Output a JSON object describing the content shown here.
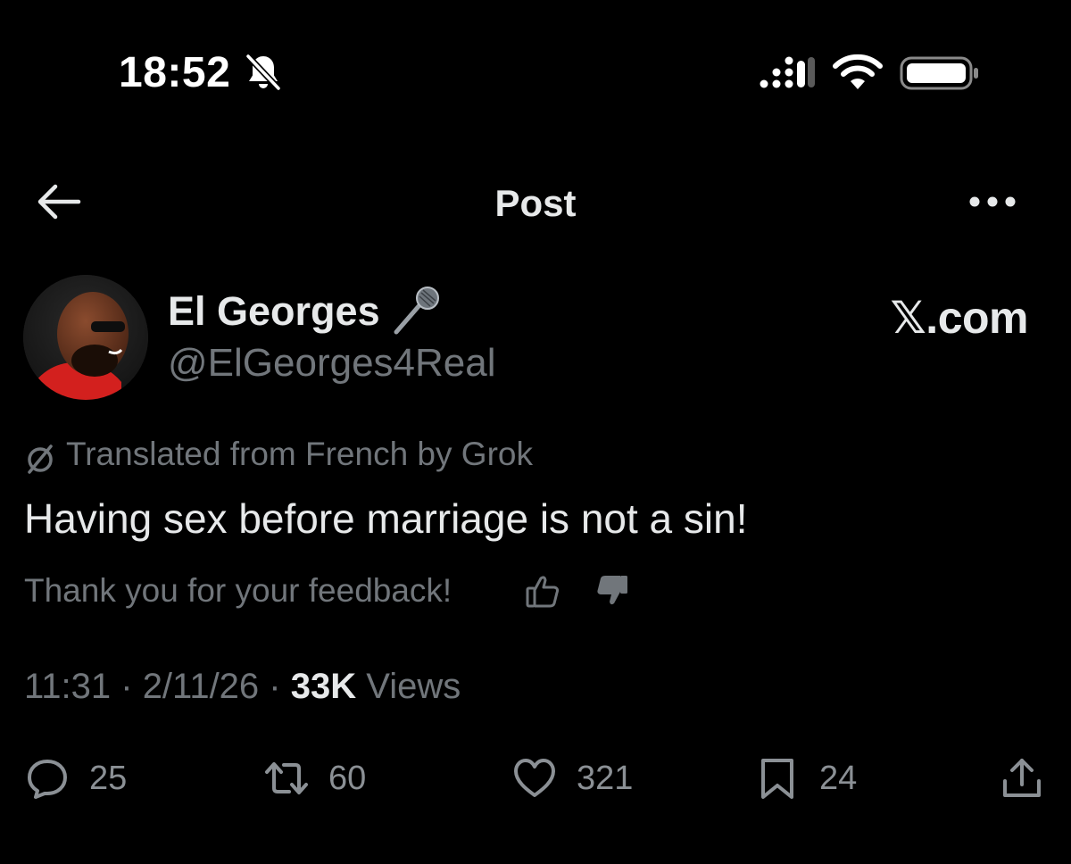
{
  "status_bar": {
    "time": "18:52",
    "icons": [
      "bell-slash-icon",
      "cellular-signal-icon",
      "wifi-icon",
      "battery-icon"
    ]
  },
  "header": {
    "title": "Post",
    "back_icon": "arrow-left-icon",
    "more_icon": "more-dots-icon"
  },
  "author": {
    "name": "El Georges",
    "name_emoji": "microphone-icon",
    "handle": "@ElGeorges4Real",
    "avatar": "avatar"
  },
  "watermark": "𝕏.com",
  "post": {
    "translation_note": "Translated from French by Grok",
    "text": "Having sex before marriage is not a sin!",
    "feedback": "Thank you for your feedback!",
    "time": "11:31",
    "date": "2/11/26",
    "views_count": "33K",
    "views_label": "Views"
  },
  "actions": {
    "replies": "25",
    "reposts": "60",
    "likes": "321",
    "bookmarks": "24"
  },
  "colors": {
    "background": "#000000",
    "primary_text": "#e7e9ea",
    "secondary_text": "#71767b"
  }
}
